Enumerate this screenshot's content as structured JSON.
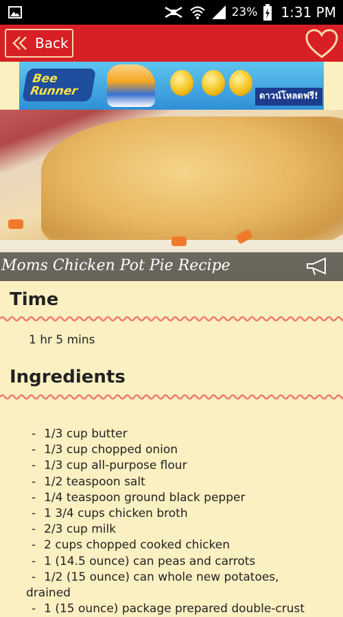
{
  "status_bar": {
    "battery_percent": "23%",
    "time": "1:31 PM"
  },
  "app_bar": {
    "back_label": "Back"
  },
  "ad_banner": {
    "logo_text": "Bee Runner",
    "cta_text": "ดาวน์โหลดฟรี!"
  },
  "recipe": {
    "title": "Moms Chicken Pot Pie Recipe"
  },
  "time_section": {
    "heading": "Time",
    "value": "1 hr 5 mins"
  },
  "ingredients_section": {
    "heading": "Ingredients",
    "items": [
      "1/3 cup butter",
      "1/3 cup chopped onion",
      "1/3 cup all-purpose flour",
      "1/2 teaspoon salt",
      "1/4 teaspoon ground black pepper",
      "1 3/4 cups chicken broth",
      "2/3 cup milk",
      "2 cups chopped cooked chicken",
      "1 (14.5 ounce) can peas and carrots"
    ],
    "wrapped_item_first": "1/2 (15 ounce) can whole new potatoes,",
    "wrapped_item_second": "drained",
    "last_item_partial": "1 (15 ounce) package prepared double-crust"
  },
  "colors": {
    "app_bar": "#d81f26",
    "background": "#fbf0c2",
    "wave": "#f07a6a"
  }
}
